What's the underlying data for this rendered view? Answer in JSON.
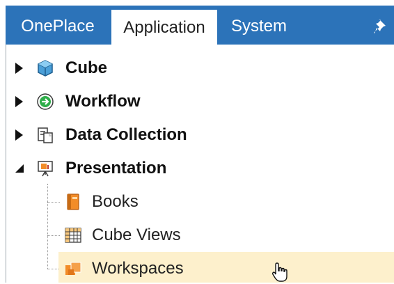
{
  "tabs": [
    {
      "label": "OnePlace",
      "active": false
    },
    {
      "label": "Application",
      "active": true
    },
    {
      "label": "System",
      "active": false
    }
  ],
  "pin_icon": "pin-icon",
  "tree": {
    "nodes": [
      {
        "label": "Cube",
        "icon": "cube-icon",
        "expanded": false
      },
      {
        "label": "Workflow",
        "icon": "workflow-icon",
        "expanded": false
      },
      {
        "label": "Data Collection",
        "icon": "data-collection-icon",
        "expanded": false
      },
      {
        "label": "Presentation",
        "icon": "presentation-icon",
        "expanded": true
      }
    ],
    "children": [
      {
        "label": "Books",
        "icon": "books-icon"
      },
      {
        "label": "Cube Views",
        "icon": "cube-views-icon"
      },
      {
        "label": "Workspaces",
        "icon": "workspaces-icon",
        "selected": true
      }
    ]
  },
  "colors": {
    "tab_bar": "#2c73b9",
    "selection": "#fdf0cc",
    "accent_orange": "#f28c28"
  }
}
